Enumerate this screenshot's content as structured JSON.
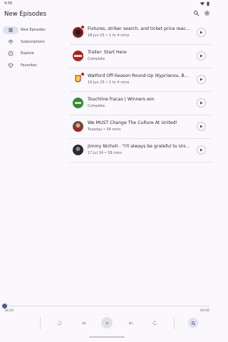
{
  "status": {
    "time": "9:56"
  },
  "appbar": {
    "title": "New Episodes",
    "search_icon": "search-icon",
    "settings_icon": "gear-icon"
  },
  "nav": {
    "items": [
      {
        "label": "New Episodes",
        "icon": "new-episodes-icon",
        "active": true
      },
      {
        "label": "Subscriptions",
        "icon": "podcast-icon",
        "active": false
      },
      {
        "label": "Explore",
        "icon": "compass-icon",
        "active": false
      },
      {
        "label": "Favorites",
        "icon": "heart-icon",
        "active": false
      }
    ]
  },
  "episodes": [
    {
      "title": "Fixtures, striker search, and ticket price reacti...",
      "meta": "18 Jun 25 • 1 hr 4 mins",
      "new": true,
      "art_color": "#8b1a1a"
    },
    {
      "title": "Trailer: Start Here",
      "meta": "Complete",
      "new": false,
      "art_color": "#b01e23"
    },
    {
      "title": "Watford Off-Season Round-Up (Kyprianou, Ba...",
      "meta": "16 Jun 25 • 1 hr 4 mins",
      "new": true,
      "art_color": "#f4d23a"
    },
    {
      "title": "Touchline fracas | Winners win",
      "meta": "Complete",
      "new": false,
      "art_color": "#2e8b3a"
    },
    {
      "title": "We MUST Change The Culture At United!",
      "meta": "Tuesday • 54 mins",
      "new": false,
      "art_color": "#6b4a3a"
    },
    {
      "title": "Jimmy Nicholl - \"I'll always be grateful to Unite...",
      "meta": "17 Jul 24 • 58 mins",
      "new": false,
      "art_color": "#2a2a2a"
    }
  ],
  "player": {
    "position": "18:29",
    "remaining": "00:00",
    "progress_fraction": 0.0
  },
  "colors": {
    "accent": "#4a5c92",
    "background": "#fbf8fd",
    "new_badge": "#c6161c"
  }
}
